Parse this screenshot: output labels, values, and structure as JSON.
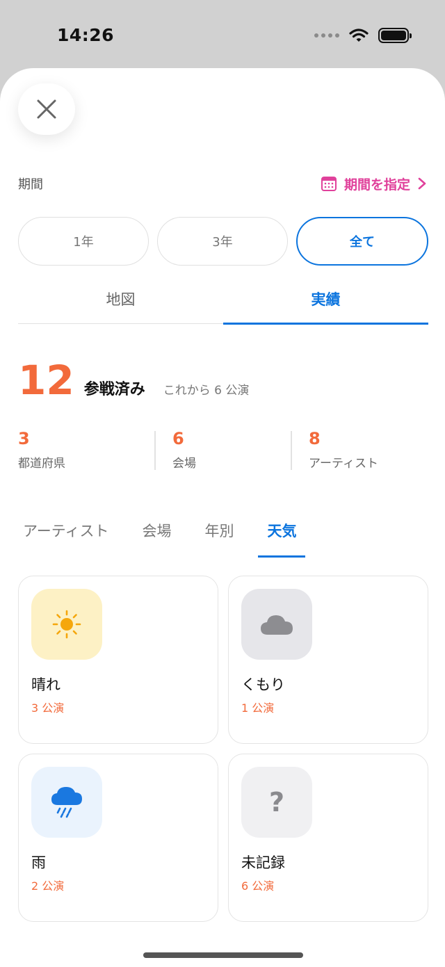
{
  "status_bar": {
    "time": "14:26"
  },
  "period": {
    "label": "期間",
    "link_label": "期間を指定"
  },
  "segments": [
    {
      "label": "1年",
      "active": false
    },
    {
      "label": "3年",
      "active": false
    },
    {
      "label": "全て",
      "active": true
    }
  ],
  "main_tabs": [
    {
      "label": "地図",
      "active": false
    },
    {
      "label": "実績",
      "active": true
    }
  ],
  "summary": {
    "count": "12",
    "label": "参戦済み",
    "upcoming": "これから 6 公演"
  },
  "stats": [
    {
      "value": "3",
      "label": "都道府県"
    },
    {
      "value": "6",
      "label": "会場"
    },
    {
      "value": "8",
      "label": "アーティスト"
    }
  ],
  "sub_tabs": [
    {
      "label": "アーティスト",
      "active": false
    },
    {
      "label": "会場",
      "active": false
    },
    {
      "label": "年別",
      "active": false
    },
    {
      "label": "天気",
      "active": true
    }
  ],
  "weather_cards": [
    {
      "name": "晴れ",
      "count": "3 公演",
      "icon": "sun-icon",
      "bg": "#fdf1c5"
    },
    {
      "name": "くもり",
      "count": "1 公演",
      "icon": "cloud-icon",
      "bg": "#e6e6ea"
    },
    {
      "name": "雨",
      "count": "2 公演",
      "icon": "rain-cloud-icon",
      "bg": "#eaf3fd"
    },
    {
      "name": "未記録",
      "count": "6 公演",
      "icon": "question-mark-icon",
      "bg": "#f0f0f2",
      "glyph": "?"
    }
  ],
  "colors": {
    "accent": "#0b74de",
    "highlight": "#f26a3b",
    "link": "#e0419b"
  }
}
